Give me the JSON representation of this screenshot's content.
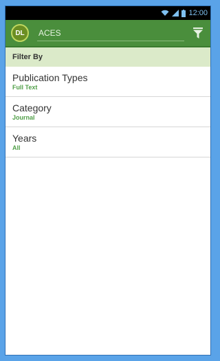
{
  "status_bar": {
    "time": "12:00"
  },
  "app_bar": {
    "logo_text": "DL",
    "search_value": "ACES"
  },
  "filter": {
    "header": "Filter By",
    "items": [
      {
        "label": "Publication Types",
        "value": "Full Text"
      },
      {
        "label": "Category",
        "value": "Journal"
      },
      {
        "label": "Years",
        "value": "All"
      }
    ]
  },
  "colors": {
    "app_bar": "#4a8e3c",
    "filter_header_bg": "#dbeac9",
    "value_text": "#52a04a",
    "page_border": "#5aa3e8"
  }
}
